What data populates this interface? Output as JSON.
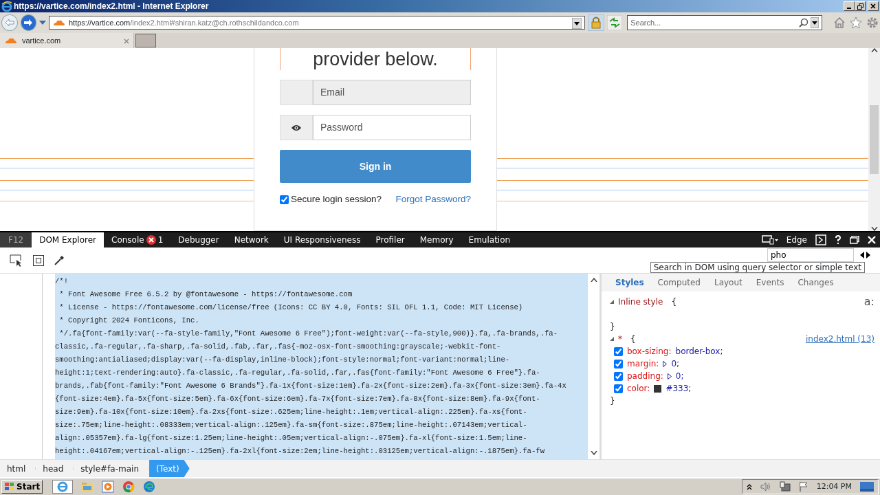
{
  "window": {
    "title": "https://vartice.com/index2.html - Internet Explorer"
  },
  "browser": {
    "address": {
      "host": "https://vartice.com",
      "path": "/index2.html#shiran.katz@ch.rothschildandco.com"
    },
    "search_placeholder": "Search...",
    "tabs": [
      {
        "label": "vartice.com",
        "selected": true
      }
    ]
  },
  "page": {
    "heading": "provider below.",
    "email_placeholder": "Email",
    "password_placeholder": "Password",
    "sign_in": "Sign in",
    "secure": {
      "label": "Secure login session?",
      "checked": true
    },
    "forgot": "Forgot Password?"
  },
  "devtools": {
    "f12": "F12",
    "tabs": [
      {
        "label": "DOM Explorer",
        "selected": true
      },
      {
        "label": "Console",
        "selected": false,
        "badge": "1"
      },
      {
        "label": "Debugger",
        "selected": false
      },
      {
        "label": "Network",
        "selected": false
      },
      {
        "label": "UI Responsiveness",
        "selected": false
      },
      {
        "label": "Profiler",
        "selected": false
      },
      {
        "label": "Memory",
        "selected": false
      },
      {
        "label": "Emulation",
        "selected": false
      }
    ],
    "mode": "Edge",
    "search": {
      "value": "pho",
      "tooltip": "Search in DOM using query selector or simple text"
    },
    "code_lines": [
      "/*!",
      " * Font Awesome Free 6.5.2 by @fontawesome - https://fontawesome.com",
      " * License - https://fontawesome.com/license/free (Icons: CC BY 4.0, Fonts: SIL OFL 1.1, Code: MIT License)",
      " * Copyright 2024 Fonticons, Inc.",
      " */.fa{font-family:var(--fa-style-family,\"Font Awesome 6 Free\");font-weight:var(--fa-style,900)}.fa,.fa-brands,.fa-",
      "classic,.fa-regular,.fa-sharp,.fa-solid,.fab,.far,.fas{-moz-osx-font-smoothing:grayscale;-webkit-font-",
      "smoothing:antialiased;display:var(--fa-display,inline-block);font-style:normal;font-variant:normal;line-",
      "height:1;text-rendering:auto}.fa-classic,.fa-regular,.fa-solid,.far,.fas{font-family:\"Font Awesome 6 Free\"}.fa-",
      "brands,.fab{font-family:\"Font Awesome 6 Brands\"}.fa-1x{font-size:1em}.fa-2x{font-size:2em}.fa-3x{font-size:3em}.fa-4x",
      "{font-size:4em}.fa-5x{font-size:5em}.fa-6x{font-size:6em}.fa-7x{font-size:7em}.fa-8x{font-size:8em}.fa-9x{font-",
      "size:9em}.fa-10x{font-size:10em}.fa-2xs{font-size:.625em;line-height:.1em;vertical-align:.225em}.fa-xs{font-",
      "size:.75em;line-height:.08333em;vertical-align:.125em}.fa-sm{font-size:.875em;line-height:.07143em;vertical-",
      "align:.05357em}.fa-lg{font-size:1.25em;line-height:.05em;vertical-align:-.075em}.fa-xl{font-size:1.5em;line-",
      "height:.04167em;vertical-align:-.125em}.fa-2xl{font-size:2em;line-height:.03125em;vertical-align:-.1875em}.fa-fw"
    ],
    "style_tabs": [
      {
        "label": "Styles",
        "selected": true
      },
      {
        "label": "Computed",
        "selected": false
      },
      {
        "label": "Layout",
        "selected": false
      },
      {
        "label": "Events",
        "selected": false
      },
      {
        "label": "Changes",
        "selected": false
      }
    ],
    "font_toggle": "a:",
    "rules": [
      {
        "selector": "Inline style",
        "open": "{",
        "close": "}"
      },
      {
        "selector": "*",
        "open": "{",
        "close": "}",
        "source": "index2.html (13)",
        "properties": [
          {
            "name": "box-sizing:",
            "value": "border-box;",
            "checked": true
          },
          {
            "name": "margin:",
            "value": "0;",
            "checked": true,
            "expandable": true
          },
          {
            "name": "padding:",
            "value": "0;",
            "checked": true,
            "expandable": true
          },
          {
            "name": "color:",
            "value": "#333;",
            "checked": true,
            "color": "#333333"
          }
        ]
      }
    ],
    "breadcrumbs": [
      {
        "label": "html",
        "selected": false
      },
      {
        "label": "head",
        "selected": false
      },
      {
        "label": "style#fa-main",
        "selected": false
      },
      {
        "label": "(Text)",
        "selected": true
      }
    ]
  },
  "taskbar": {
    "start": "Start",
    "time": "12:04 PM"
  }
}
